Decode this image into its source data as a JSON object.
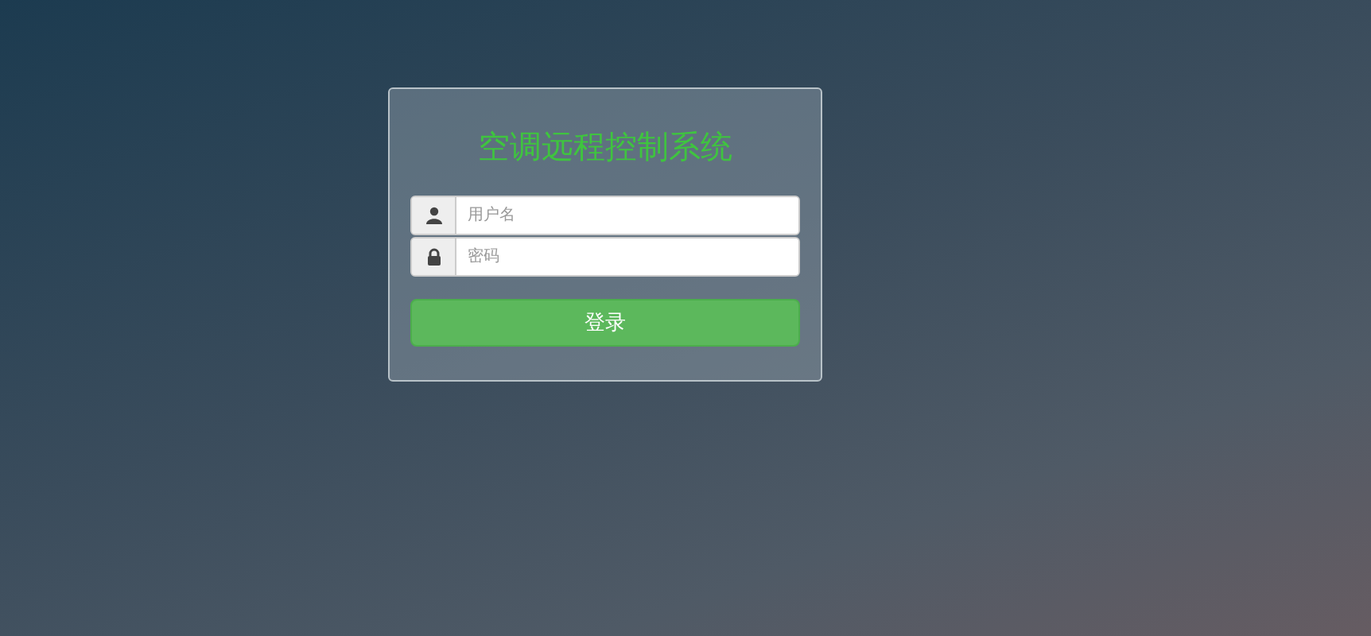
{
  "login": {
    "title": "空调远程控制系统",
    "fields": [
      {
        "kind": "user",
        "placeholder": "用户名"
      },
      {
        "kind": "password",
        "placeholder": "密码"
      }
    ],
    "button": "登录"
  }
}
